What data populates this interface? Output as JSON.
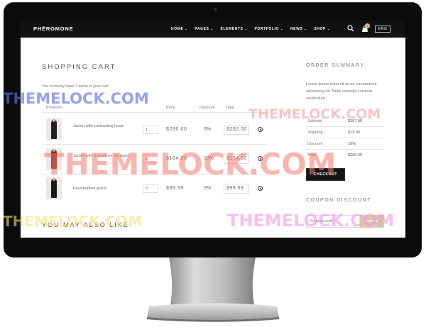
{
  "brand": "PHĒROMONE",
  "nav": {
    "items": [
      "HOME",
      "PAGES",
      "ELEMENTS",
      "PORTFOLIO",
      "NEWS",
      "SHOP"
    ],
    "cart_count": "0",
    "language": "ENG",
    "icons": {
      "search": "search-icon",
      "cart": "cart-icon"
    }
  },
  "cart": {
    "title": "SHOPPING CART",
    "subtitle": "You currently have 3 items in your cart",
    "headers": {
      "products": "Products",
      "price": "Price",
      "discount": "Discount",
      "total": "Total"
    },
    "items": [
      {
        "name": "Jacket with contrasting hood",
        "qty": "1",
        "price": "$280.00",
        "discount": "5%",
        "total": "$252.00"
      },
      {
        "name": "Jacket with a seam on the lapel",
        "qty": "1",
        "price": "$164.00",
        "discount": "10%",
        "total": "$154.00"
      },
      {
        "name": "Faux leather jacket",
        "qty": "2",
        "price": "$99.99",
        "discount": "0%",
        "total": "$99.99"
      }
    ]
  },
  "also": "YOU MAY ALSO LIKE",
  "summary": {
    "title": "ORDER SUMMARY",
    "description": "Lorem ipsum dolor sit amet, connectetur adipiscing elit. Nulla convallis pulvinar vestibulum",
    "rows": [
      {
        "label": "Subtotal",
        "value": "$387.00"
      },
      {
        "label": "Shipping",
        "value": "$13.00"
      },
      {
        "label": "Discount",
        "value": "10%"
      },
      {
        "label": "Total",
        "value": "$360.00"
      }
    ],
    "checkout": "CHECKOUT"
  },
  "coupon": {
    "title": "COUPON DISCOUNT",
    "placeholder": "Coupon code",
    "apply": "APPLY"
  },
  "watermark": "THEMELOCK.COM",
  "colors": {
    "accent": "#d9c7a6",
    "nav_bg": "#101113",
    "badge": "#e8c86a"
  }
}
